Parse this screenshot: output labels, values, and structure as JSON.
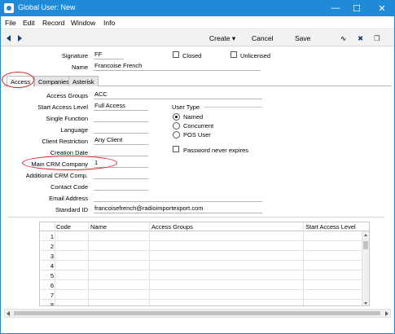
{
  "window": {
    "title": "Global User: New",
    "minimize_glyph": "—",
    "maximize_glyph": "☐",
    "close_glyph": "✕"
  },
  "menu": [
    "File",
    "Edit",
    "Record",
    "Window",
    "Info"
  ],
  "toolbar": {
    "create_label": "Create",
    "create_arrow": "▾",
    "cancel_label": "Cancel",
    "save_label": "Save",
    "activity_glyph": "∿",
    "expand_glyph": "✖",
    "detach_glyph": "❐"
  },
  "header": {
    "signature_label": "Signature",
    "signature_value": "FF",
    "name_label": "Name",
    "name_value": "Francoise French",
    "closed_label": "Closed",
    "unlicensed_label": "Unlicensed"
  },
  "tabs": [
    {
      "label": "Access",
      "active": true
    },
    {
      "label": "Companies",
      "active": false
    },
    {
      "label": "Asterisk",
      "active": false
    }
  ],
  "access": {
    "access_groups_label": "Access Groups",
    "access_groups_value": "ACC",
    "start_access_level_label": "Start Access Level",
    "start_access_level_value": "Full Access",
    "single_function_label": "Single Function",
    "single_function_value": "",
    "language_label": "Language",
    "language_value": "",
    "client_restriction_label": "Client Restriction",
    "client_restriction_value": "Any Client",
    "creation_date_label": "Creation Date",
    "creation_date_value": "",
    "main_crm_company_label": "Main CRM Company",
    "main_crm_company_value": "1",
    "additional_crm_comp_label": "Additional CRM Comp.",
    "additional_crm_comp_value": "",
    "contact_code_label": "Contact Code",
    "contact_code_value": "",
    "email_address_label": "Email Address",
    "email_address_value": "",
    "standard_id_label": "Standard ID",
    "standard_id_value": "francoisefrench@radioimportexport.com",
    "user_type_label": "User Type",
    "user_type_options": [
      "Named",
      "Concurrent",
      "POS User"
    ],
    "user_type_selected": "Named",
    "password_never_expires_label": "Password never expires"
  },
  "grid": {
    "columns": [
      "Code",
      "Name",
      "Access Groups",
      "Start Access Level"
    ],
    "rows": [
      "1",
      "2",
      "3",
      "4",
      "5",
      "6",
      "7",
      "8"
    ]
  },
  "colors": {
    "titlebar": "#1f8ad8",
    "annotation": "#d61f26",
    "nav_arrows": "#1d3f73"
  }
}
